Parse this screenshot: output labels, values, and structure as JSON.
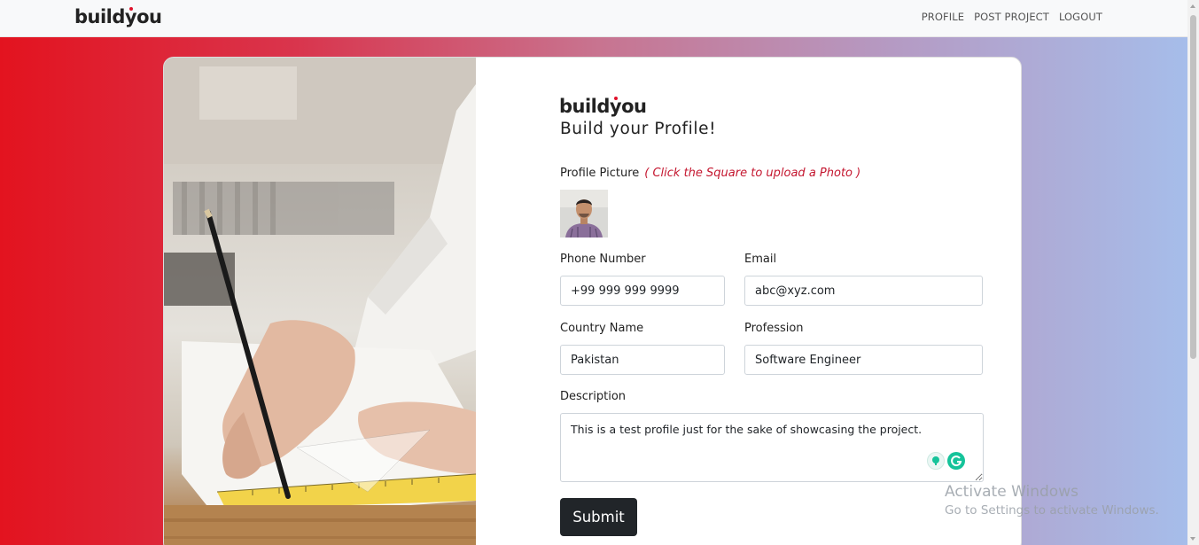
{
  "nav": {
    "brand": "buildyou",
    "links": [
      "PROFILE",
      "POST PROJECT",
      "LOGOUT"
    ]
  },
  "form": {
    "brand": "buildyou",
    "heading": "Build your Profile!",
    "profile_picture": {
      "label": "Profile Picture",
      "hint": "( Click the Square to upload a Photo )"
    },
    "phone": {
      "label": "Phone Number",
      "value": "+99 999 999 9999"
    },
    "email": {
      "label": "Email",
      "value": "abc@xyz.com"
    },
    "country": {
      "label": "Country Name",
      "value": "Pakistan"
    },
    "profession": {
      "label": "Profession",
      "value": "Software Engineer"
    },
    "description": {
      "label": "Description",
      "value": "This is a test profile just for the sake of showcasing the project."
    },
    "submit_label": "Submit"
  },
  "watermark": {
    "title": "Activate Windows",
    "subtitle": "Go to Settings to activate Windows."
  },
  "colors": {
    "accent": "#e0112b",
    "hint": "#c4162f",
    "button": "#212529",
    "gradient_start": "#e3131f",
    "gradient_end": "#a6bdea"
  },
  "icons": [
    "grammarly-suggestion-icon",
    "grammarly-icon"
  ]
}
